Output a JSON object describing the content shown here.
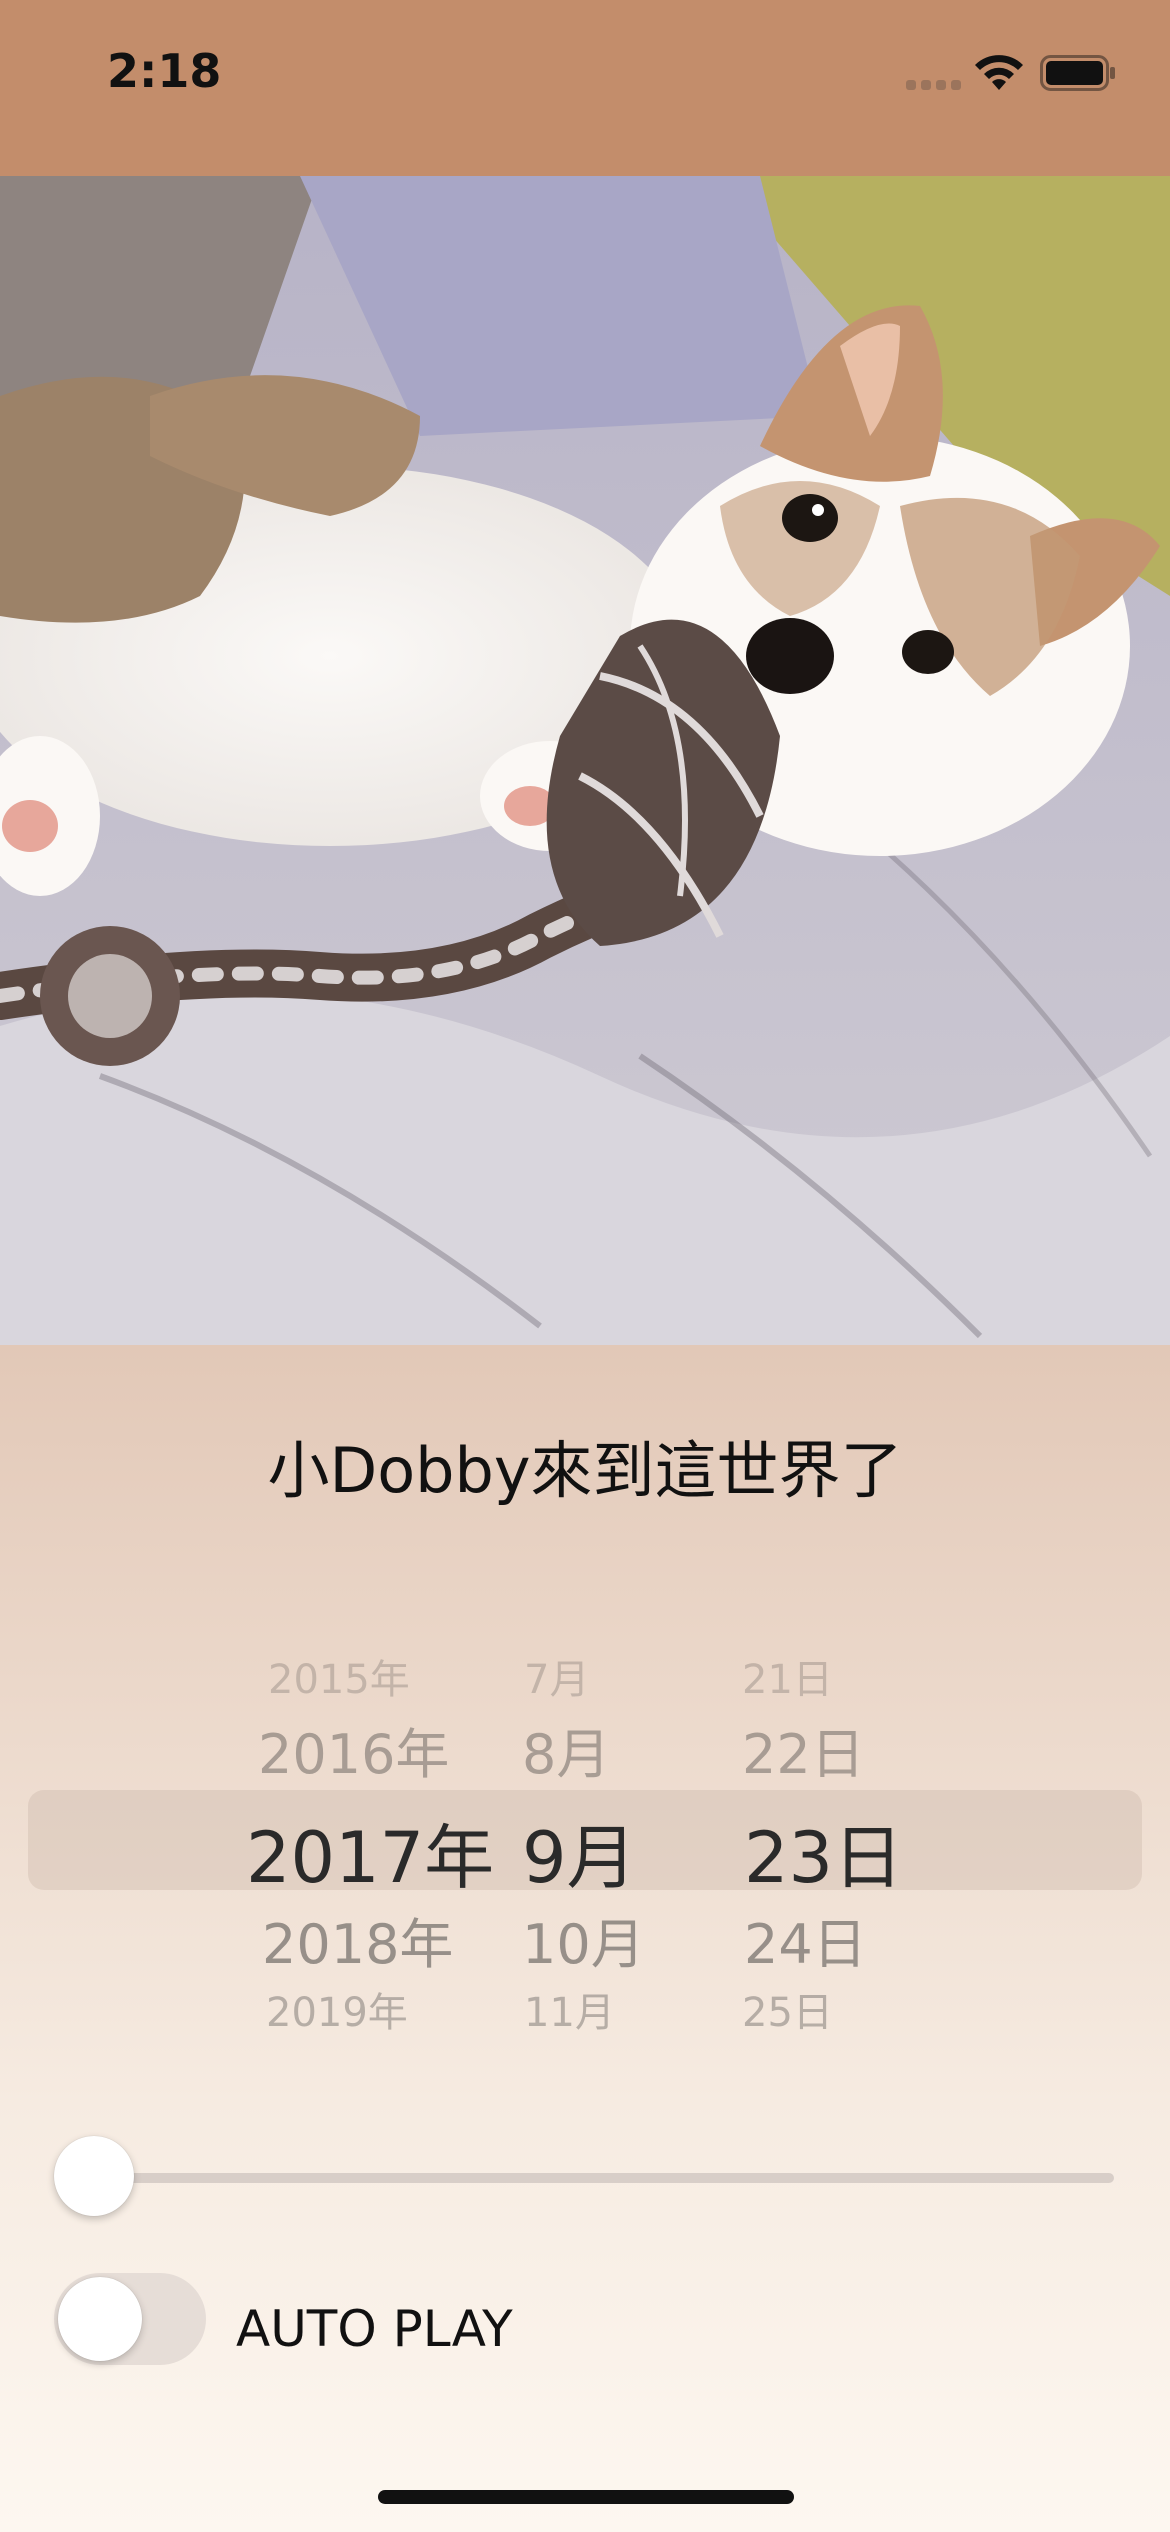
{
  "status_bar": {
    "time": "2:18",
    "icons": [
      "signal-icon",
      "wifi-icon",
      "battery-icon"
    ]
  },
  "photo": {
    "alt_icon": "corgi-puppy-photo"
  },
  "caption": "小Dobby來到這世界了",
  "date_picker": {
    "years": [
      "2015年",
      "2016年",
      "2017年",
      "2018年",
      "2019年"
    ],
    "months": [
      "7月",
      "8月",
      "9月",
      "10月",
      "11月"
    ],
    "days": [
      "21日",
      "22日",
      "23日",
      "24日",
      "25日"
    ],
    "selected": {
      "year": "2017年",
      "month": "9月",
      "day": "23日"
    }
  },
  "slider": {
    "value_fraction": 0
  },
  "auto_play": {
    "label": "AUTO PLAY",
    "on": false
  },
  "colors": {
    "header": "#c38d6b",
    "background_top": "#e2c8b7",
    "background_bottom": "#fdf7f0"
  }
}
